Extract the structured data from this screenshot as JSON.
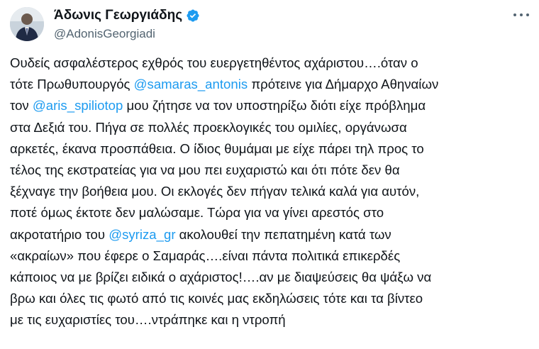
{
  "author": {
    "display_name": "Άδωνις Γεωργιάδης",
    "handle": "@AdonisGeorgiadi",
    "verified": true,
    "avatar_icon": "profile-photo",
    "more_icon": "more-options-icon"
  },
  "colors": {
    "mention": "#1d9bf0",
    "text": "#0f1419",
    "secondary": "#536471",
    "verified_badge": "#1d9bf0"
  },
  "tweet": {
    "lines": [
      [
        {
          "t": "Ουδείς ασφαλέστερος εχθρός του ευεργετηθέντος αχάριστου….όταν ο"
        }
      ],
      [
        {
          "t": "τότε Πρωθυπουργός "
        },
        {
          "t": "@samaras_antonis",
          "mention": true
        },
        {
          "t": " πρότεινε για Δήμαρχο Αθηναίων"
        }
      ],
      [
        {
          "t": "τον "
        },
        {
          "t": "@aris_spiliotop",
          "mention": true
        },
        {
          "t": " μου ζήτησε να τον υποστηρίξω διότι είχε πρόβλημα"
        }
      ],
      [
        {
          "t": "στα Δεξιά του. Πήγα σε πολλές προεκλογικές του ομιλίες, οργάνωσα"
        }
      ],
      [
        {
          "t": "αρκετές, έκανα προσπάθεια. Ο ίδιος θυμάμαι με είχε πάρει τηλ προς το"
        }
      ],
      [
        {
          "t": "τέλος της εκστρατείας για να μου πει ευχαριστώ και ότι πότε δεν θα"
        }
      ],
      [
        {
          "t": "ξέχναγε την βοήθεια μου. Οι εκλογές δεν πήγαν τελικά καλά για αυτόν,"
        }
      ],
      [
        {
          "t": "ποτέ όμως έκτοτε δεν μαλώσαμε. Τώρα για να γίνει αρεστός στο"
        }
      ],
      [
        {
          "t": "ακροτατήριο του "
        },
        {
          "t": "@syriza_gr",
          "mention": true
        },
        {
          "t": " ακολουθεί την πεπατημένη κατά των"
        }
      ],
      [
        {
          "t": "«ακραίων» που έφερε ο Σαμαράς….είναι πάντα πολιτικά επικερδές"
        }
      ],
      [
        {
          "t": "κάποιος να με βρίζει ειδικά ο αχάριστος!….αν με διαψεύσεις θα ψάξω να"
        }
      ],
      [
        {
          "t": "βρω και όλες τις φωτό από τις κοινές μας εκδηλώσεις τότε και τα βίντεο"
        }
      ],
      [
        {
          "t": "με τις ευχαριστίες του….ντράπηκε και η ντροπή"
        }
      ]
    ]
  }
}
